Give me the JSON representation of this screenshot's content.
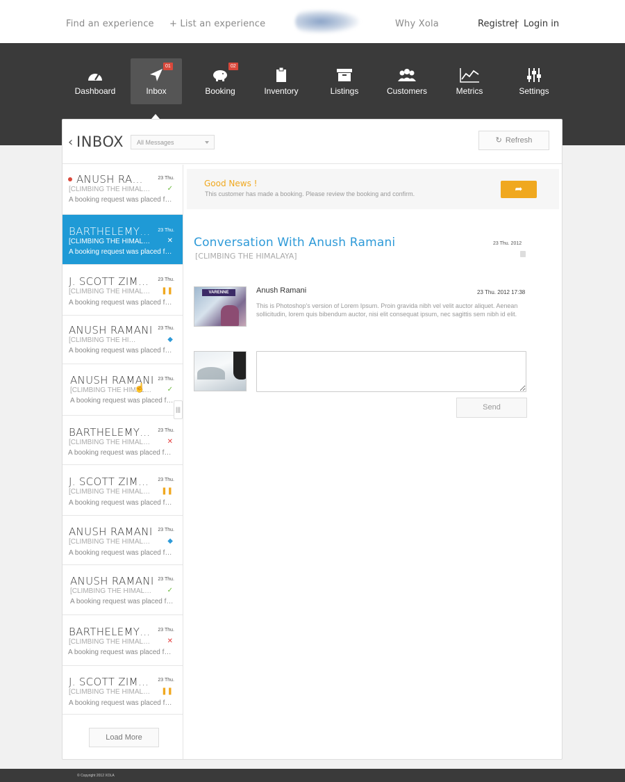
{
  "topnav": {
    "find": "Find an experience",
    "list": "+ List an experience",
    "why": "Why Xola",
    "register": "Registrer",
    "separator": "|",
    "login": "Login in"
  },
  "nav": {
    "items": [
      {
        "label": "Dashboard",
        "icon": "gauge-icon"
      },
      {
        "label": "Inbox",
        "icon": "paper-plane-icon",
        "badge": "01",
        "active": true
      },
      {
        "label": "Booking",
        "icon": "piggy-bank-icon",
        "badge": "02"
      },
      {
        "label": "Inventory",
        "icon": "clipboard-icon"
      },
      {
        "label": "Listings",
        "icon": "archive-box-icon"
      },
      {
        "label": "Customers",
        "icon": "users-icon"
      },
      {
        "label": "Metrics",
        "icon": "line-chart-icon"
      },
      {
        "label": "Settings",
        "icon": "sliders-icon"
      }
    ]
  },
  "inbox": {
    "back": "‹",
    "title": "INBOX",
    "filter": "All Messages",
    "refresh": "Refresh",
    "load_more": "Load More"
  },
  "messages": [
    {
      "name": "ANUSH RAMANI",
      "date": "23 Thu.",
      "sub": "[CLIMBING THE HIMALAYA]",
      "preview": "A booking request was placed for you",
      "status": "ok",
      "unread": true
    },
    {
      "name": "BARTHELEMY OSTERMAN",
      "date": "23 Thu.",
      "sub": "[CLIMBING THE HIMALAYA]",
      "preview": "A booking request was placed for you",
      "status": "x",
      "selected": true
    },
    {
      "name": "J. SCOTT ZIMMERMAN",
      "date": "23 Thu.",
      "sub": "[CLIMBING THE HIMALAYA]",
      "preview": "A booking request was placed for you",
      "status": "pause"
    },
    {
      "name": "ANUSH RAMANI",
      "date": "23 Thu.",
      "sub": "[CLIMBING THE HIMALAYA]",
      "preview": "A booking request was placed for you",
      "status": "tag"
    },
    {
      "name": "ANUSH RAMANI",
      "date": "23 Thu.",
      "sub": "[CLIMBING THE HIMALAYA]",
      "preview": "A booking request was placed for you",
      "status": "ok"
    },
    {
      "name": "BARTHELEMY OSTERMAN",
      "date": "23 Thu.",
      "sub": "[CLIMBING THE HIMALAYA]",
      "preview": "A booking request was placed for you",
      "status": "x"
    },
    {
      "name": "J. SCOTT ZIMMERMAN",
      "date": "23 Thu.",
      "sub": "[CLIMBING THE HIMALAYA]",
      "preview": "A booking request was placed for you",
      "status": "pause"
    },
    {
      "name": "ANUSH RAMANI",
      "date": "23 Thu.",
      "sub": "[CLIMBING THE HIMALAYA]",
      "preview": "A booking request was placed for you",
      "status": "tag"
    },
    {
      "name": "ANUSH RAMANI",
      "date": "23 Thu.",
      "sub": "[CLIMBING THE HIMALAYA]",
      "preview": "A booking request was placed for you",
      "status": "ok"
    },
    {
      "name": "BARTHELEMY OSTERMAN",
      "date": "23 Thu.",
      "sub": "[CLIMBING THE HIMALAYA]",
      "preview": "A booking request was placed for you",
      "status": "x"
    },
    {
      "name": "J. SCOTT ZIMMERMAN",
      "date": "23 Thu.",
      "sub": "[CLIMBING THE HIMALAYA]",
      "preview": "A booking request was placed for you",
      "status": "pause"
    }
  ],
  "notice": {
    "title": "Good News !",
    "body": "This customer has made a booking. Please review the booking and confirm.",
    "button_icon": "share-arrow-icon"
  },
  "conversation": {
    "title": "Conversation With Anush Ramani",
    "subtitle": "[CLIMBING THE HIMALAYA]",
    "date": "23 Thu. 2012",
    "message": {
      "author": "Anush Ramani",
      "date": "23 Thu. 2012 17:38",
      "body": "This is Photoshop's version  of Lorem Ipsum. Proin gravida nibh vel velit auctor aliquet. Aenean sollicitudin, lorem quis bibendum auctor, nisi elit consequat ipsum, nec sagittis sem nibh id elit.",
      "avatar_sign": "VARENNE"
    },
    "reply_placeholder": "",
    "send": "Send"
  },
  "footer": {
    "copyright": "© Copyright 2012 XOLA"
  },
  "colors": {
    "accent": "#1f9ad6",
    "notice": "#f0a81f",
    "nav_bg": "#3a3a3a",
    "unread": "#d9483b"
  }
}
